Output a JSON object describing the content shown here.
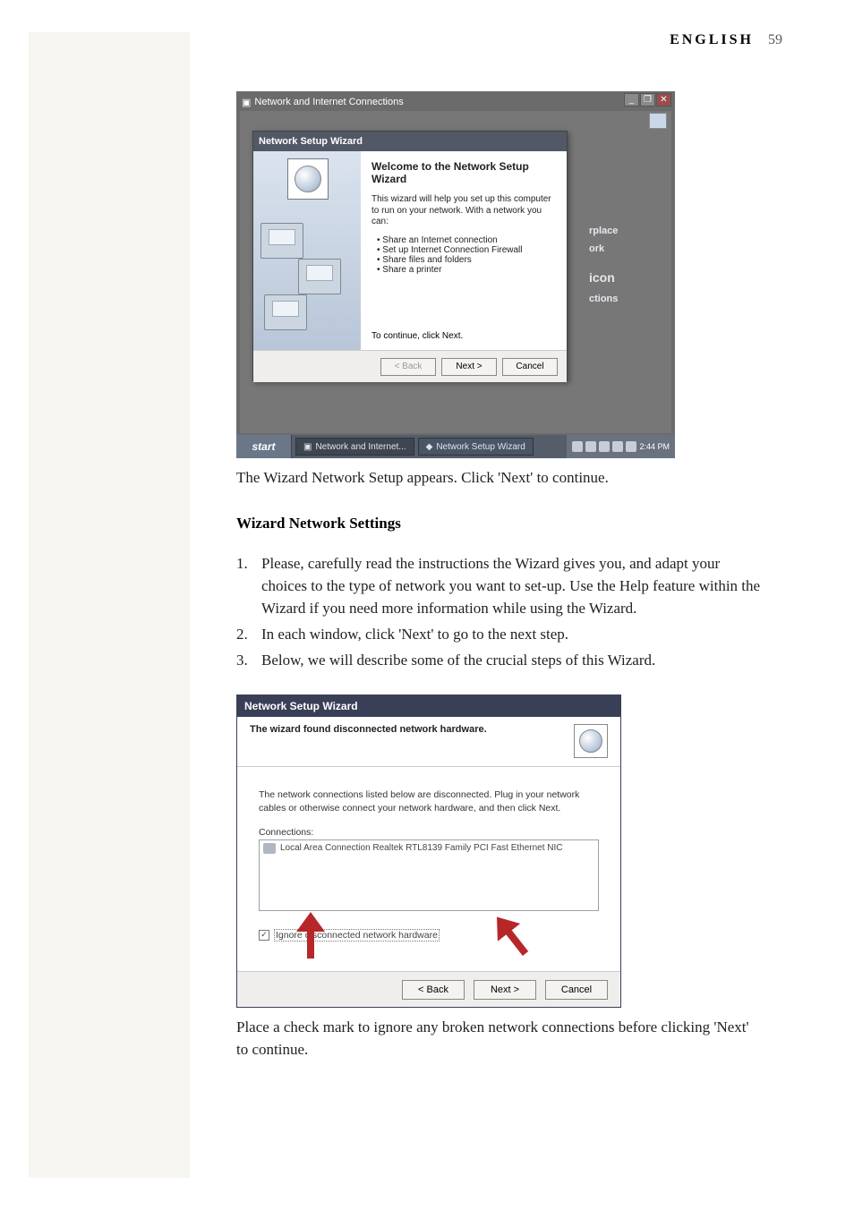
{
  "header": {
    "language": "ENGLISH",
    "page_number": "59"
  },
  "screenshot1": {
    "parent_window_title": "Network and Internet Connections",
    "right_text_1": "rplace",
    "right_text_2": "ork",
    "right_text_3": "icon",
    "right_text_4": "ctions",
    "wizard": {
      "title": "Network Setup Wizard",
      "heading": "Welcome to the Network Setup Wizard",
      "intro": "This wizard will help you set up this computer to run on your network. With a network you can:",
      "bullets": [
        "Share an Internet connection",
        "Set up Internet Connection Firewall",
        "Share files and folders",
        "Share a printer"
      ],
      "continue_text": "To continue, click Next.",
      "buttons": {
        "back": "< Back",
        "next": "Next >",
        "cancel": "Cancel"
      }
    },
    "window_controls": {
      "minimize": "_",
      "maximize": "❐",
      "close": "✕"
    },
    "taskbar": {
      "start": "start",
      "task1": "Network and Internet...",
      "task2": "Network Setup Wizard",
      "time": "2:44 PM"
    }
  },
  "caption1": "The Wizard Network Setup appears. Click 'Next' to continue.",
  "section_heading": "Wizard Network Settings",
  "instructions": [
    "Please, carefully read the instructions the Wizard gives you, and adapt your choices to the type of network you want to set-up. Use the Help feature within the Wizard if you need more information while using the Wizard.",
    "In each window, click 'Next' to go to the next step.",
    "Below, we will describe some of the crucial steps of this Wizard."
  ],
  "screenshot2": {
    "title": "Network Setup Wizard",
    "subheading": "The wizard found disconnected network hardware.",
    "description": "The network connections listed below are disconnected. Plug in your network cables or otherwise connect your network hardware, and then click Next.",
    "connections_label": "Connections:",
    "connection_item": "Local Area Connection   Realtek RTL8139 Family PCI Fast Ethernet NIC",
    "checkbox_label": "Ignore disconnected network hardware",
    "checkbox_mark": "✓",
    "buttons": {
      "back": "< Back",
      "next": "Next >",
      "cancel": "Cancel"
    }
  },
  "caption2": "Place a check mark to ignore any broken network connections before clicking 'Next' to continue."
}
